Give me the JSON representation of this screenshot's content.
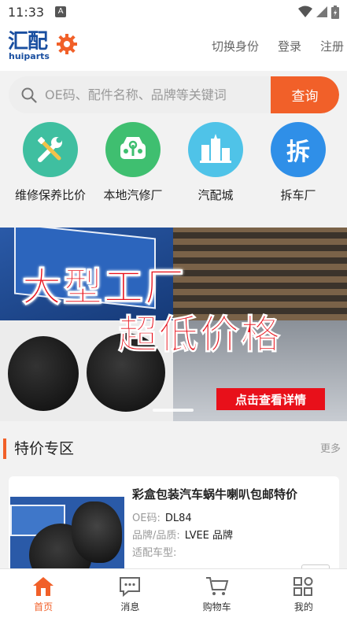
{
  "status": {
    "time": "11:33",
    "notif_letter": "A",
    "icons": [
      "wifi-icon",
      "signal-icon",
      "battery-icon"
    ]
  },
  "header": {
    "logo_cn": "汇配",
    "logo_en": "huiparts",
    "links": [
      "切换身份",
      "登录",
      "注册"
    ]
  },
  "search": {
    "placeholder": "OE码、配件名称、品牌等关键词",
    "button": "查询"
  },
  "quick_nav": [
    {
      "label": "维修保养比价",
      "icon": "wrench-icon",
      "color": "#3fbfa0"
    },
    {
      "label": "本地汽修厂",
      "icon": "car-repair-icon",
      "color": "#3fbf70"
    },
    {
      "label": "汽配城",
      "icon": "building-icon",
      "color": "#4fc3e8"
    },
    {
      "label": "拆车厂",
      "icon": "dismantle-icon",
      "color": "#2f8fe8",
      "glyph": "拆"
    }
  ],
  "banner": {
    "line1": "大型工厂",
    "line2": "超低价格",
    "cta": "点击查看详情"
  },
  "section": {
    "title": "特价专区",
    "more": "更多"
  },
  "product": {
    "title": "彩盒包装汽车蜗牛喇叭包邮特价",
    "oe_label": "OE码:",
    "oe_value": "DL84",
    "brand_label": "品牌/品质:",
    "brand_value": "LVEE 品牌",
    "model_label": "适配车型:",
    "model_value": ""
  },
  "tabs": [
    {
      "label": "首页",
      "icon": "home-icon",
      "active": true
    },
    {
      "label": "消息",
      "icon": "message-icon",
      "active": false
    },
    {
      "label": "购物车",
      "icon": "cart-icon",
      "active": false
    },
    {
      "label": "我的",
      "icon": "profile-grid-icon",
      "active": false
    }
  ],
  "colors": {
    "accent": "#f16029",
    "brand_blue": "#1a4fa0",
    "banner_red": "#e8101a"
  }
}
